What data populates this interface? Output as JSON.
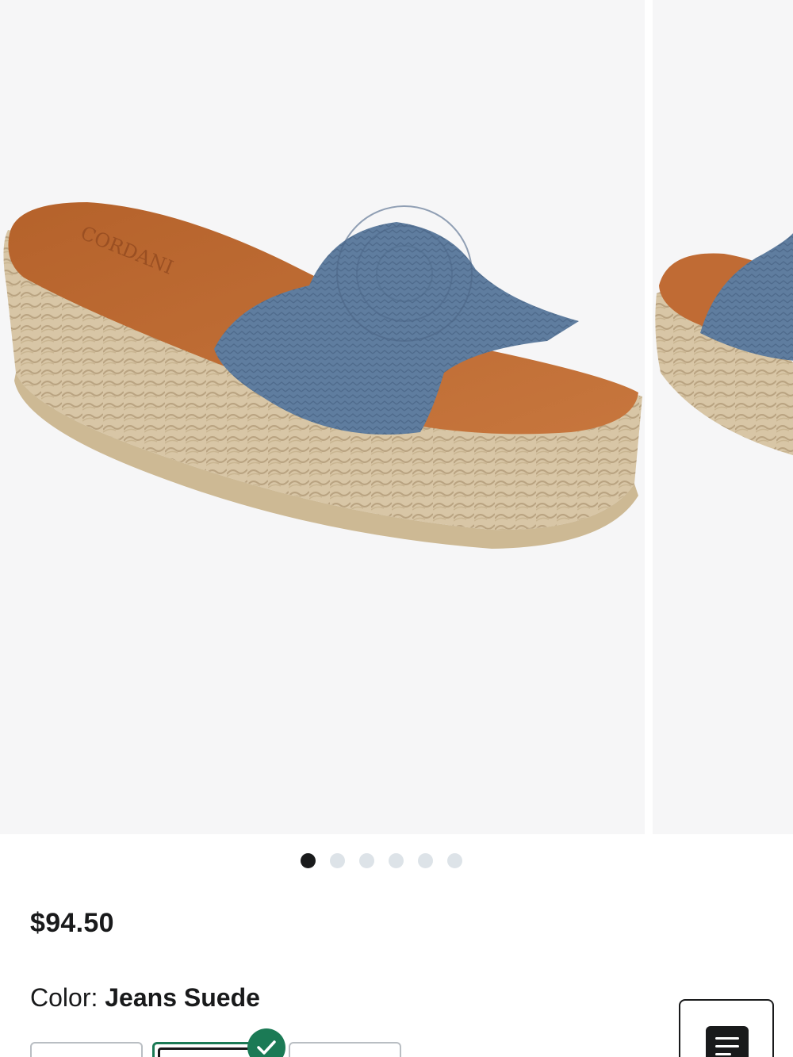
{
  "product": {
    "image_alt": "Blue woven platform slide sandal",
    "price": "$94.50",
    "color_label": "Color:",
    "color_value": "Jeans Suede"
  },
  "gallery": {
    "dot_count": 6,
    "active_index": 0
  },
  "colors": {
    "selected_border": "#1b7a55",
    "text": "#191a1b",
    "dot_inactive": "#dde3e8",
    "background": "#f6f6f7"
  }
}
